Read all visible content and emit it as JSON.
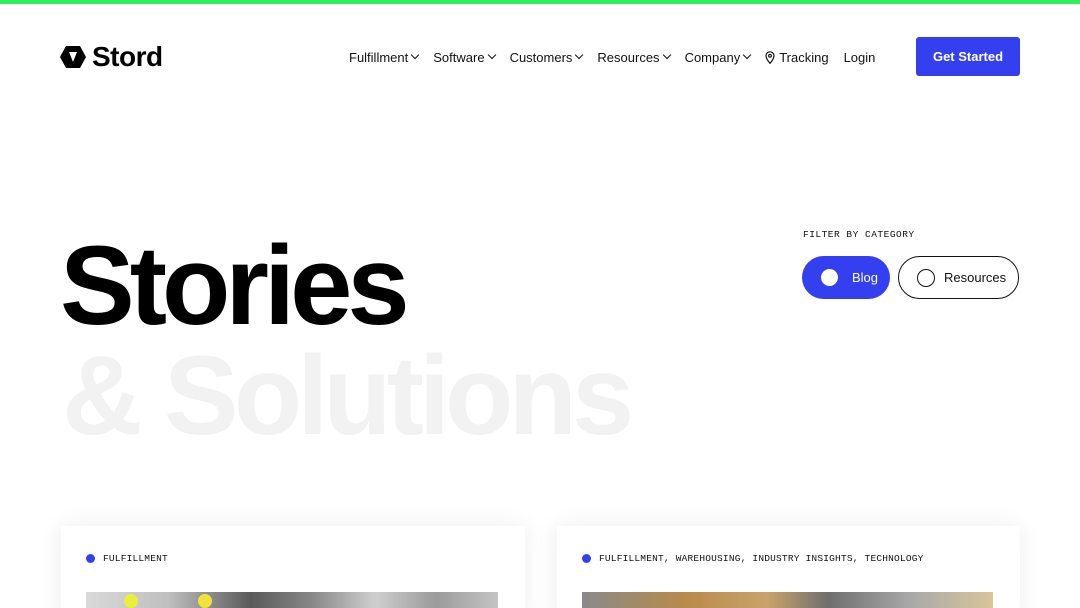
{
  "colors": {
    "accent_bar": "#2ef05a",
    "brand_blue": "#3440f0",
    "ghost_text": "#f2f2f2"
  },
  "header": {
    "logo_text": "Stord",
    "logo_icon": "stord-hexagon-icon",
    "nav": [
      {
        "label": "Fulfillment",
        "has_dropdown": true
      },
      {
        "label": "Software",
        "has_dropdown": true
      },
      {
        "label": "Customers",
        "has_dropdown": true
      },
      {
        "label": "Resources",
        "has_dropdown": true
      },
      {
        "label": "Company",
        "has_dropdown": true
      }
    ],
    "tracking_label": "Tracking",
    "tracking_icon": "map-pin-icon",
    "login_label": "Login",
    "cta_label": "Get Started"
  },
  "hero": {
    "title": "Stories",
    "subtitle": "& Solutions"
  },
  "filter": {
    "label": "FILTER BY CATEGORY",
    "options": [
      {
        "label": "Blog",
        "selected": true
      },
      {
        "label": "Resources",
        "selected": false
      }
    ]
  },
  "cards": [
    {
      "tags": "FULFILLMENT"
    },
    {
      "tags": "FULFILLMENT, WAREHOUSING, INDUSTRY INSIGHTS, TECHNOLOGY"
    }
  ]
}
